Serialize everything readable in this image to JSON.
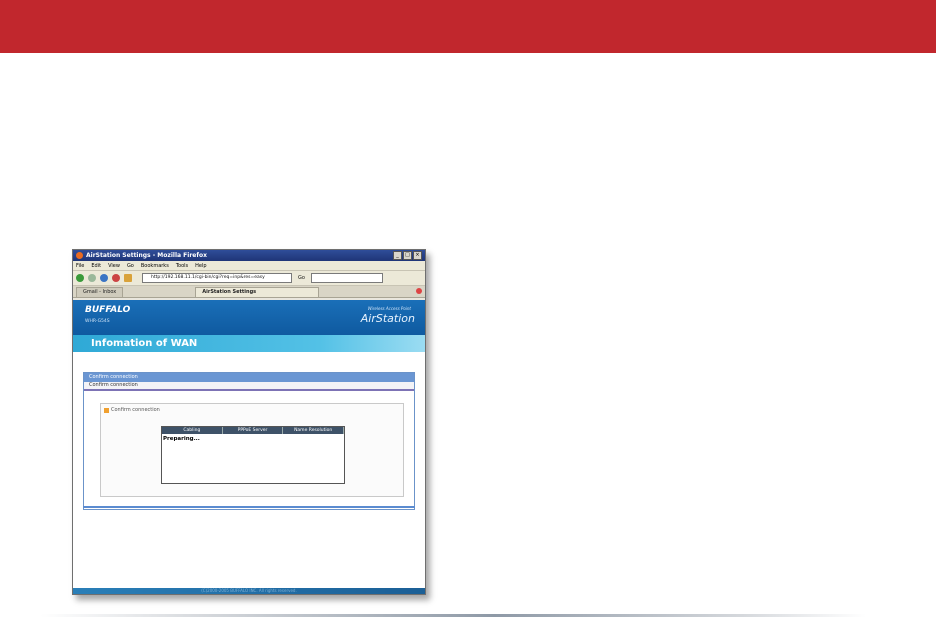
{
  "browser": {
    "window_title": "AirStation Settings - Mozilla Firefox",
    "menu": [
      "File",
      "Edit",
      "View",
      "Go",
      "Bookmarks",
      "Tools",
      "Help"
    ],
    "url": "http://192.168.11.1/cgi-bin/cgi?req=inp&res=easy",
    "go_label": "Go",
    "tabs": [
      "Gmail - Inbox",
      "AirStation Settings"
    ]
  },
  "page": {
    "brand": "BUFFALO",
    "model": "WHR-G54S",
    "product_subtitle": "Wireless Access Point",
    "product_name": "AirStation",
    "title": "Infomation of WAN",
    "panel_title": "Confirm connection",
    "panel_subtitle": "Confirm connection",
    "inner_title": "Confirm connection",
    "table_headers": [
      "Cabling",
      "PPPoE Server",
      "Name Resolution"
    ],
    "status_text": "Preparing...",
    "footer": "(C)2000-2005 BUFFALO INC. All rights reserved."
  },
  "colors": {
    "top_banner": "#c1272d",
    "header_blue": "#1a6fb8",
    "title_bar": "#2fa9d6"
  }
}
